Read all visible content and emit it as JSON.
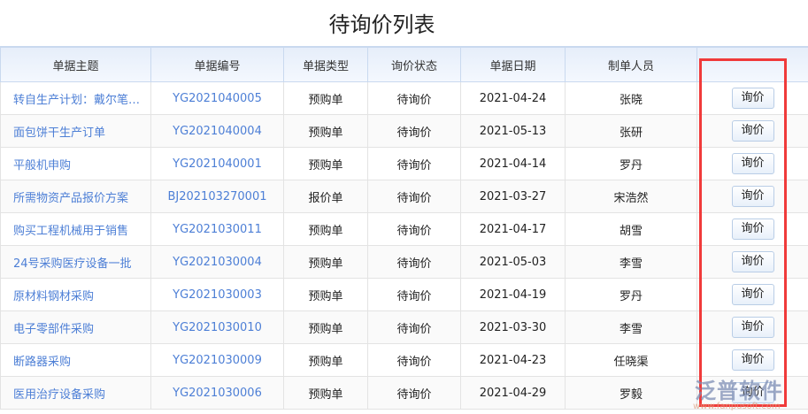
{
  "title": "待询价列表",
  "headers": [
    "单据主题",
    "单据编号",
    "单据类型",
    "询价状态",
    "单据日期",
    "制单人员",
    ""
  ],
  "rows": [
    {
      "subject": "转自生产计划：戴尔笔记本",
      "no": "YG2021040005",
      "type": "预购单",
      "status": "待询价",
      "date": "2021-04-24",
      "creator": "张晓",
      "action": "询价"
    },
    {
      "subject": "面包饼干生产订单",
      "no": "YG2021040004",
      "type": "预购单",
      "status": "待询价",
      "date": "2021-05-13",
      "creator": "张研",
      "action": "询价"
    },
    {
      "subject": "平般机申购",
      "no": "YG2021040001",
      "type": "预购单",
      "status": "待询价",
      "date": "2021-04-14",
      "creator": "罗丹",
      "action": "询价"
    },
    {
      "subject": "所需物资产品报价方案",
      "no": "BJ202103270001",
      "type": "报价单",
      "status": "待询价",
      "date": "2021-03-27",
      "creator": "宋浩然",
      "action": "询价"
    },
    {
      "subject": "购买工程机械用于销售",
      "no": "YG2021030011",
      "type": "预购单",
      "status": "待询价",
      "date": "2021-04-17",
      "creator": "胡雪",
      "action": "询价"
    },
    {
      "subject": "24号采购医疗设备一批",
      "no": "YG2021030004",
      "type": "预购单",
      "status": "待询价",
      "date": "2021-05-03",
      "creator": "李雪",
      "action": "询价"
    },
    {
      "subject": "原材料钢材采购",
      "no": "YG2021030003",
      "type": "预购单",
      "status": "待询价",
      "date": "2021-04-19",
      "creator": "罗丹",
      "action": "询价"
    },
    {
      "subject": "电子零部件采购",
      "no": "YG2021030010",
      "type": "预购单",
      "status": "待询价",
      "date": "2021-03-30",
      "creator": "李雪",
      "action": "询价"
    },
    {
      "subject": "断路器采购",
      "no": "YG2021030009",
      "type": "预购单",
      "status": "待询价",
      "date": "2021-04-23",
      "creator": "任晓渠",
      "action": "询价"
    },
    {
      "subject": "医用治疗设备采购",
      "no": "YG2021030006",
      "type": "预购单",
      "status": "待询价",
      "date": "2021-04-29",
      "creator": "罗毅",
      "action": "询价"
    }
  ],
  "watermark": {
    "name": "泛普软件",
    "url": "www.fanpusoft.com"
  }
}
